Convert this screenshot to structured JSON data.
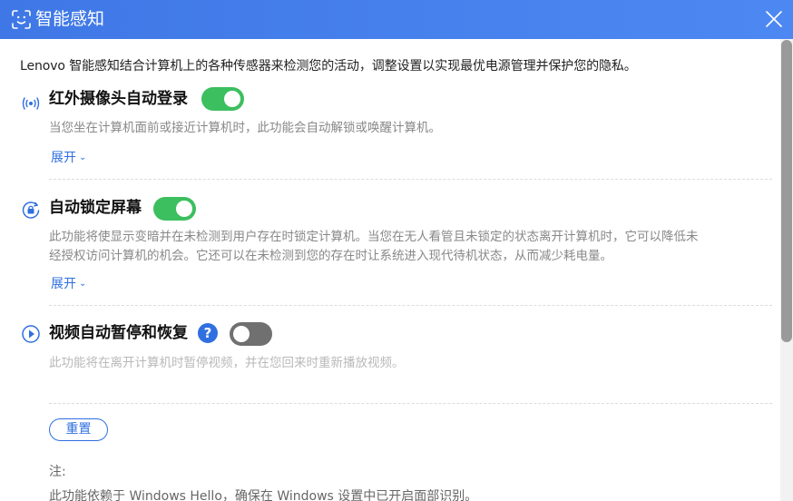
{
  "window": {
    "title": "智能感知",
    "title_icon": "face-scan-icon",
    "close_icon": "close-icon"
  },
  "intro": "Lenovo 智能感知结合计算机上的各种传感器来检测您的活动，调整设置以实现最优电源管理并保护您的隐私。",
  "sections": [
    {
      "icon": "infrared-signal-icon",
      "title": "红外摄像头自动登录",
      "enabled": true,
      "description": [
        "当您坐在计算机面前或接近计算机时，此功能会自动解锁或唤醒计算机。"
      ],
      "expand_label": "展开"
    },
    {
      "icon": "auto-lock-icon",
      "title": "自动锁定屏幕",
      "enabled": true,
      "description": [
        "此功能将使显示变暗并在未检测到用户存在时锁定计算机。当您在无人看管且未锁定的状态离开计算机时，它可以降低未",
        "经授权访问计算机的机会。它还可以在未检测到您的存在时让系统进入现代待机状态，从而减少耗电量。"
      ],
      "expand_label": "展开"
    },
    {
      "icon": "play-circle-icon",
      "title": "视频自动暂停和恢复",
      "help": "?",
      "enabled": false,
      "description": [
        "此功能将在离开计算机时暂停视频，并在您回来时重新播放视频。"
      ]
    }
  ],
  "reset_label": "重置",
  "note_label": "注:",
  "note_text": "此功能依赖于 Windows Hello，确保在 Windows 设置中已开启面部识别。",
  "colors": {
    "titlebar": "#4a84ef",
    "toggle_on": "#3cbf5f",
    "toggle_off": "#707070",
    "link": "#2f6fe0"
  }
}
